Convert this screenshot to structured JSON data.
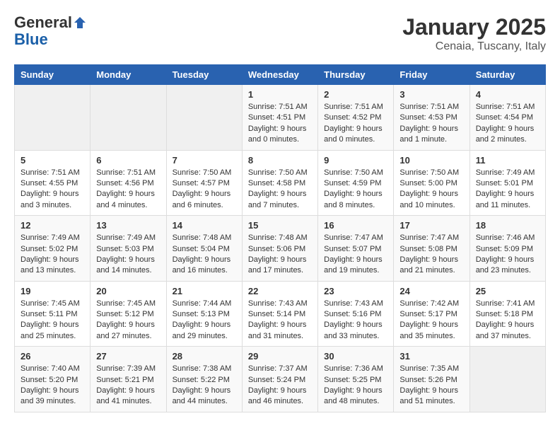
{
  "header": {
    "logo_general": "General",
    "logo_blue": "Blue",
    "month_title": "January 2025",
    "location": "Cenaia, Tuscany, Italy"
  },
  "weekdays": [
    "Sunday",
    "Monday",
    "Tuesday",
    "Wednesday",
    "Thursday",
    "Friday",
    "Saturday"
  ],
  "weeks": [
    [
      {
        "day": "",
        "sunrise": "",
        "sunset": "",
        "daylight": ""
      },
      {
        "day": "",
        "sunrise": "",
        "sunset": "",
        "daylight": ""
      },
      {
        "day": "",
        "sunrise": "",
        "sunset": "",
        "daylight": ""
      },
      {
        "day": "1",
        "sunrise": "Sunrise: 7:51 AM",
        "sunset": "Sunset: 4:51 PM",
        "daylight": "Daylight: 9 hours and 0 minutes."
      },
      {
        "day": "2",
        "sunrise": "Sunrise: 7:51 AM",
        "sunset": "Sunset: 4:52 PM",
        "daylight": "Daylight: 9 hours and 0 minutes."
      },
      {
        "day": "3",
        "sunrise": "Sunrise: 7:51 AM",
        "sunset": "Sunset: 4:53 PM",
        "daylight": "Daylight: 9 hours and 1 minute."
      },
      {
        "day": "4",
        "sunrise": "Sunrise: 7:51 AM",
        "sunset": "Sunset: 4:54 PM",
        "daylight": "Daylight: 9 hours and 2 minutes."
      }
    ],
    [
      {
        "day": "5",
        "sunrise": "Sunrise: 7:51 AM",
        "sunset": "Sunset: 4:55 PM",
        "daylight": "Daylight: 9 hours and 3 minutes."
      },
      {
        "day": "6",
        "sunrise": "Sunrise: 7:51 AM",
        "sunset": "Sunset: 4:56 PM",
        "daylight": "Daylight: 9 hours and 4 minutes."
      },
      {
        "day": "7",
        "sunrise": "Sunrise: 7:50 AM",
        "sunset": "Sunset: 4:57 PM",
        "daylight": "Daylight: 9 hours and 6 minutes."
      },
      {
        "day": "8",
        "sunrise": "Sunrise: 7:50 AM",
        "sunset": "Sunset: 4:58 PM",
        "daylight": "Daylight: 9 hours and 7 minutes."
      },
      {
        "day": "9",
        "sunrise": "Sunrise: 7:50 AM",
        "sunset": "Sunset: 4:59 PM",
        "daylight": "Daylight: 9 hours and 8 minutes."
      },
      {
        "day": "10",
        "sunrise": "Sunrise: 7:50 AM",
        "sunset": "Sunset: 5:00 PM",
        "daylight": "Daylight: 9 hours and 10 minutes."
      },
      {
        "day": "11",
        "sunrise": "Sunrise: 7:49 AM",
        "sunset": "Sunset: 5:01 PM",
        "daylight": "Daylight: 9 hours and 11 minutes."
      }
    ],
    [
      {
        "day": "12",
        "sunrise": "Sunrise: 7:49 AM",
        "sunset": "Sunset: 5:02 PM",
        "daylight": "Daylight: 9 hours and 13 minutes."
      },
      {
        "day": "13",
        "sunrise": "Sunrise: 7:49 AM",
        "sunset": "Sunset: 5:03 PM",
        "daylight": "Daylight: 9 hours and 14 minutes."
      },
      {
        "day": "14",
        "sunrise": "Sunrise: 7:48 AM",
        "sunset": "Sunset: 5:04 PM",
        "daylight": "Daylight: 9 hours and 16 minutes."
      },
      {
        "day": "15",
        "sunrise": "Sunrise: 7:48 AM",
        "sunset": "Sunset: 5:06 PM",
        "daylight": "Daylight: 9 hours and 17 minutes."
      },
      {
        "day": "16",
        "sunrise": "Sunrise: 7:47 AM",
        "sunset": "Sunset: 5:07 PM",
        "daylight": "Daylight: 9 hours and 19 minutes."
      },
      {
        "day": "17",
        "sunrise": "Sunrise: 7:47 AM",
        "sunset": "Sunset: 5:08 PM",
        "daylight": "Daylight: 9 hours and 21 minutes."
      },
      {
        "day": "18",
        "sunrise": "Sunrise: 7:46 AM",
        "sunset": "Sunset: 5:09 PM",
        "daylight": "Daylight: 9 hours and 23 minutes."
      }
    ],
    [
      {
        "day": "19",
        "sunrise": "Sunrise: 7:45 AM",
        "sunset": "Sunset: 5:11 PM",
        "daylight": "Daylight: 9 hours and 25 minutes."
      },
      {
        "day": "20",
        "sunrise": "Sunrise: 7:45 AM",
        "sunset": "Sunset: 5:12 PM",
        "daylight": "Daylight: 9 hours and 27 minutes."
      },
      {
        "day": "21",
        "sunrise": "Sunrise: 7:44 AM",
        "sunset": "Sunset: 5:13 PM",
        "daylight": "Daylight: 9 hours and 29 minutes."
      },
      {
        "day": "22",
        "sunrise": "Sunrise: 7:43 AM",
        "sunset": "Sunset: 5:14 PM",
        "daylight": "Daylight: 9 hours and 31 minutes."
      },
      {
        "day": "23",
        "sunrise": "Sunrise: 7:43 AM",
        "sunset": "Sunset: 5:16 PM",
        "daylight": "Daylight: 9 hours and 33 minutes."
      },
      {
        "day": "24",
        "sunrise": "Sunrise: 7:42 AM",
        "sunset": "Sunset: 5:17 PM",
        "daylight": "Daylight: 9 hours and 35 minutes."
      },
      {
        "day": "25",
        "sunrise": "Sunrise: 7:41 AM",
        "sunset": "Sunset: 5:18 PM",
        "daylight": "Daylight: 9 hours and 37 minutes."
      }
    ],
    [
      {
        "day": "26",
        "sunrise": "Sunrise: 7:40 AM",
        "sunset": "Sunset: 5:20 PM",
        "daylight": "Daylight: 9 hours and 39 minutes."
      },
      {
        "day": "27",
        "sunrise": "Sunrise: 7:39 AM",
        "sunset": "Sunset: 5:21 PM",
        "daylight": "Daylight: 9 hours and 41 minutes."
      },
      {
        "day": "28",
        "sunrise": "Sunrise: 7:38 AM",
        "sunset": "Sunset: 5:22 PM",
        "daylight": "Daylight: 9 hours and 44 minutes."
      },
      {
        "day": "29",
        "sunrise": "Sunrise: 7:37 AM",
        "sunset": "Sunset: 5:24 PM",
        "daylight": "Daylight: 9 hours and 46 minutes."
      },
      {
        "day": "30",
        "sunrise": "Sunrise: 7:36 AM",
        "sunset": "Sunset: 5:25 PM",
        "daylight": "Daylight: 9 hours and 48 minutes."
      },
      {
        "day": "31",
        "sunrise": "Sunrise: 7:35 AM",
        "sunset": "Sunset: 5:26 PM",
        "daylight": "Daylight: 9 hours and 51 minutes."
      },
      {
        "day": "",
        "sunrise": "",
        "sunset": "",
        "daylight": ""
      }
    ]
  ]
}
